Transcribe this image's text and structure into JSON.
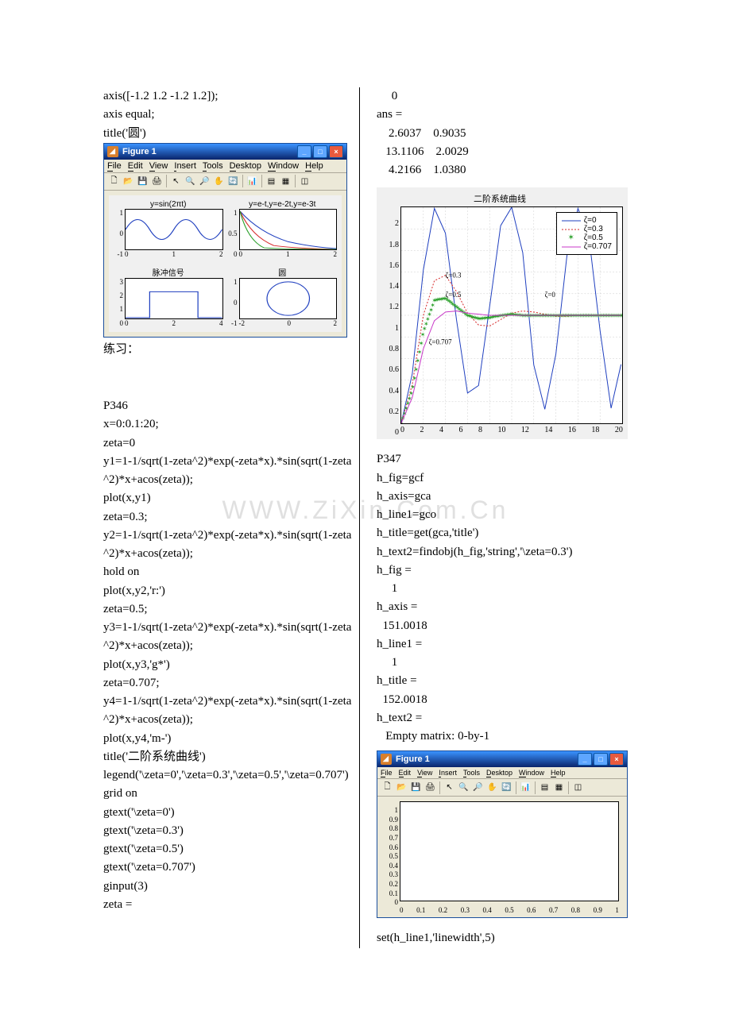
{
  "watermark": "WWW.ZiXin.Com.Cn",
  "left": {
    "lines": [
      "axis([-1.2 1.2 -1.2 1.2]);",
      "axis equal;",
      "title('圆')"
    ],
    "practice_label": "练习：",
    "code2": [
      "P346",
      "x=0:0.1:20;",
      "zeta=0",
      "y1=1-1/sqrt(1-zeta^2)*exp(-zeta*x).*sin(sqrt(1-zeta^2)*x+acos(zeta));",
      "plot(x,y1)",
      "zeta=0.3;",
      "y2=1-1/sqrt(1-zeta^2)*exp(-zeta*x).*sin(sqrt(1-zeta^2)*x+acos(zeta));",
      "hold on",
      "plot(x,y2,'r:')",
      "zeta=0.5;",
      "y3=1-1/sqrt(1-zeta^2)*exp(-zeta*x).*sin(sqrt(1-zeta^2)*x+acos(zeta));",
      "plot(x,y3,'g*')",
      "zeta=0.707;",
      "y4=1-1/sqrt(1-zeta^2)*exp(-zeta*x).*sin(sqrt(1-zeta^2)*x+acos(zeta));",
      "plot(x,y4,'m-')",
      "title('二阶系统曲线')",
      "legend('\\zeta=0','\\zeta=0.3','\\zeta=0.5','\\zeta=0.707')",
      "grid on",
      "gtext('\\zeta=0')",
      "gtext('\\zeta=0.3')",
      "gtext('\\zeta=0.5')",
      "gtext('\\zeta=0.707')",
      "ginput(3)",
      "zeta ="
    ]
  },
  "right": {
    "output1": [
      "     0",
      "ans =",
      "    2.6037    0.9035",
      "   13.1106    2.0029",
      "    4.2166    1.0380"
    ],
    "code2": [
      "P347",
      "h_fig=gcf",
      "h_axis=gca",
      "h_line1=gco",
      "h_title=get(gca,'title')",
      "h_text2=findobj(h_fig,'string','\\zeta=0.3')",
      "h_fig =",
      "     1",
      "h_axis =",
      "  151.0018",
      "h_line1 =",
      "     1",
      "h_title =",
      "  152.0018",
      "h_text2 =",
      "   Empty matrix: 0-by-1"
    ],
    "last_line": "set(h_line1,'linewidth',5)"
  },
  "fig1": {
    "title": "Figure 1",
    "menu": [
      "File",
      "Edit",
      "View",
      "Insert",
      "Tools",
      "Desktop",
      "Window",
      "Help"
    ],
    "subplots": [
      {
        "title": "y=sin(2πt)",
        "yticks": [
          "1",
          "0",
          "-1"
        ],
        "xticks": [
          "0",
          "1",
          "2"
        ]
      },
      {
        "title": "y=e-t,y=e-2t,y=e-3t",
        "yticks": [
          "1",
          "0.5",
          "0"
        ],
        "xticks": [
          "0",
          "1",
          "2"
        ]
      },
      {
        "title": "脉冲信号",
        "yticks": [
          "3",
          "2",
          "1",
          "0"
        ],
        "xticks": [
          "0",
          "2",
          "4"
        ]
      },
      {
        "title": "圆",
        "yticks": [
          "1",
          "0",
          "-1"
        ],
        "xticks": [
          "-2",
          "0",
          "2"
        ]
      }
    ]
  },
  "chart_data": {
    "type": "line",
    "title": "二阶系统曲线",
    "xlabel": "",
    "ylabel": "",
    "xlim": [
      0,
      20
    ],
    "ylim": [
      0,
      2
    ],
    "xticks": [
      "0",
      "2",
      "4",
      "6",
      "8",
      "10",
      "12",
      "14",
      "16",
      "18",
      "20"
    ],
    "yticks": [
      "0",
      "0.2",
      "0.4",
      "0.6",
      "0.8",
      "1",
      "1.2",
      "1.4",
      "1.6",
      "1.8",
      "2"
    ],
    "grid": true,
    "legend_position": "top-right",
    "series": [
      {
        "name": "ζ=0",
        "style": "blue-solid",
        "x": [
          0,
          1,
          2,
          3,
          4,
          5,
          6,
          7,
          8,
          9,
          10,
          11,
          12,
          13,
          14,
          15,
          16,
          17,
          18,
          19,
          20
        ],
        "values": [
          0,
          0.46,
          1.42,
          1.99,
          1.76,
          0.96,
          0.28,
          0.35,
          1.08,
          1.83,
          2.0,
          1.58,
          0.54,
          0.13,
          0.64,
          1.55,
          1.99,
          1.72,
          0.86,
          0.14,
          0.59
        ]
      },
      {
        "name": "ζ=0.3",
        "style": "red-dotted",
        "x": [
          0,
          1,
          2,
          3,
          4,
          5,
          6,
          7,
          8,
          9,
          10,
          11,
          12,
          13,
          14,
          15,
          16,
          17,
          18,
          19,
          20
        ],
        "values": [
          0,
          0.36,
          1.0,
          1.32,
          1.37,
          1.22,
          1.02,
          0.91,
          0.9,
          0.96,
          1.02,
          1.04,
          1.03,
          1.01,
          0.99,
          0.99,
          1.0,
          1.0,
          1.0,
          1.0,
          1.0
        ]
      },
      {
        "name": "ζ=0.5",
        "style": "green-star",
        "x": [
          0,
          1,
          2,
          3,
          4,
          5,
          6,
          7,
          8,
          9,
          10,
          11,
          12,
          13,
          14,
          15,
          16,
          17,
          18,
          19,
          20
        ],
        "values": [
          0,
          0.31,
          0.85,
          1.14,
          1.16,
          1.08,
          1.0,
          0.97,
          0.98,
          1.0,
          1.01,
          1.0,
          1.0,
          1.0,
          1.0,
          1.0,
          1.0,
          1.0,
          1.0,
          1.0,
          1.0
        ]
      },
      {
        "name": "ζ=0.707",
        "style": "magenta-solid",
        "x": [
          0,
          1,
          2,
          3,
          4,
          5,
          6,
          7,
          8,
          9,
          10,
          11,
          12,
          13,
          14,
          15,
          16,
          17,
          18,
          19,
          20
        ],
        "values": [
          0,
          0.24,
          0.69,
          0.95,
          1.03,
          1.04,
          1.02,
          1.01,
          1.0,
          1.0,
          1.0,
          1.0,
          1.0,
          1.0,
          1.0,
          1.0,
          1.0,
          1.0,
          1.0,
          1.0,
          1.0
        ]
      }
    ],
    "gtext_labels": [
      {
        "text": "ζ=0.3",
        "x": 4.0,
        "y": 1.35
      },
      {
        "text": "ζ=0.5",
        "x": 4.0,
        "y": 1.17
      },
      {
        "text": "ζ=0.707",
        "x": 2.5,
        "y": 0.73
      },
      {
        "text": "ζ=0",
        "x": 13.0,
        "y": 1.17
      }
    ],
    "ginput_points": [
      {
        "x": 2.6037,
        "y": 0.9035
      },
      {
        "x": 13.1106,
        "y": 2.0029
      },
      {
        "x": 4.2166,
        "y": 1.038
      }
    ]
  },
  "empty_chart": {
    "xticks": [
      "0",
      "0.1",
      "0.2",
      "0.3",
      "0.4",
      "0.5",
      "0.6",
      "0.7",
      "0.8",
      "0.9",
      "1"
    ],
    "yticks": [
      "0",
      "0.1",
      "0.2",
      "0.3",
      "0.4",
      "0.5",
      "0.6",
      "0.7",
      "0.8",
      "0.9",
      "1"
    ]
  }
}
